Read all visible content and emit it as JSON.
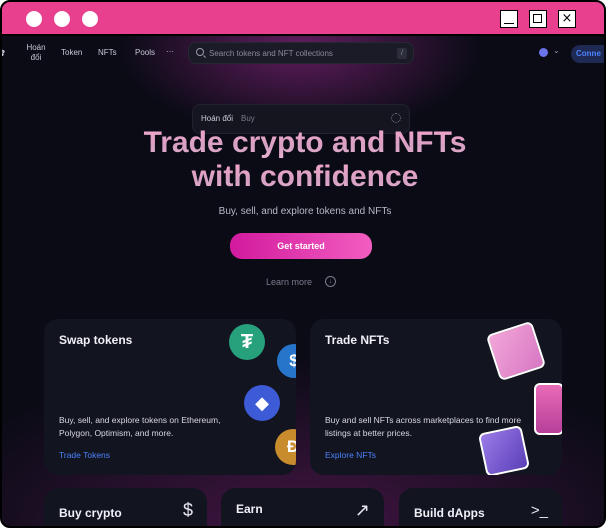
{
  "window": {
    "controls": {
      "minimize": "",
      "maximize": "",
      "close": "×"
    }
  },
  "nav": {
    "swap_label": "Hoán đổi",
    "swap_label_line1": "Hoán",
    "swap_label_line2": "đổi",
    "tokens_label": "Token",
    "nfts_label": "NFTs",
    "pools_label": "Pools",
    "more_label": "···",
    "search_placeholder": "Search tokens and NFT collections",
    "search_shortcut": "/",
    "connect_label": "Conne"
  },
  "swap_widget": {
    "tab_swap": "Hoán đổi",
    "tab_buy": "Buy"
  },
  "hero": {
    "title_line1": "Trade crypto and NFTs",
    "title_line2": "with confidence",
    "subtitle": "Buy, sell, and explore tokens and NFTs",
    "cta_label": "Get started",
    "learn_more": "Learn more"
  },
  "cards": {
    "swap": {
      "title": "Swap tokens",
      "description": "Buy, sell, and explore tokens on Ethereum, Polygon, Optimism, and more.",
      "link": "Trade Tokens",
      "coin_icons": [
        "tether-icon",
        "usdc-icon",
        "ethereum-icon",
        "dai-icon"
      ]
    },
    "nft": {
      "title": "Trade NFTs",
      "description": "Buy and sell NFTs across marketplaces to find more listings at better prices.",
      "link": "Explore NFTs"
    },
    "buy": {
      "title": "Buy crypto",
      "icon": "$"
    },
    "earn": {
      "title": "Earn",
      "icon": "↗"
    },
    "build": {
      "title": "Build dApps",
      "icon": ">_"
    }
  },
  "colors": {
    "accent_pink": "#e8408f",
    "cta": "#d21a9e",
    "link_blue": "#4c82fb"
  }
}
